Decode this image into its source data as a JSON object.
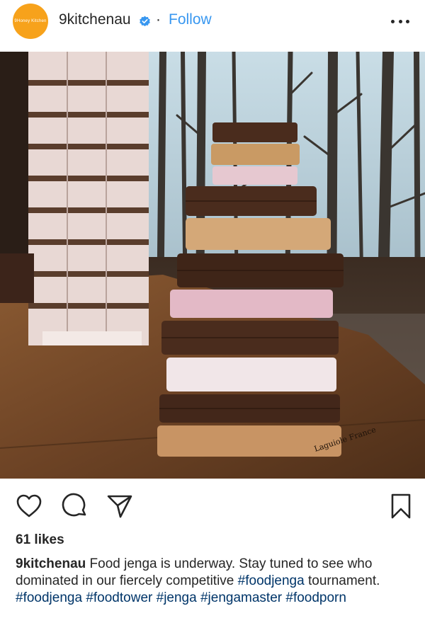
{
  "post": {
    "avatar_text": "9Honey Kitchen",
    "username": "9kitchenau",
    "separator": "·",
    "follow_label": "Follow",
    "likes": "61 likes",
    "caption_user": "9kitchenau",
    "caption_text": "Food jenga is underway. Stay tuned to see who dominated in our fiercely competitive",
    "hashtags_line1": [
      "#foodjenga"
    ],
    "caption_text2": "tournament.",
    "hashtags_line2": [
      "#foodjenga",
      "#foodtower",
      "#jenga",
      "#jengamaster",
      "#foodporn"
    ]
  },
  "icons": {
    "avatar": "avatar-logo",
    "verified": "verified-badge-icon",
    "more": "more-options-icon",
    "like": "heart-icon",
    "comment": "comment-icon",
    "share": "share-icon",
    "save": "bookmark-icon"
  },
  "colors": {
    "link": "#3897f0",
    "hashtag": "#003569",
    "avatar_bg": "#f7a21b",
    "text": "#262626"
  }
}
